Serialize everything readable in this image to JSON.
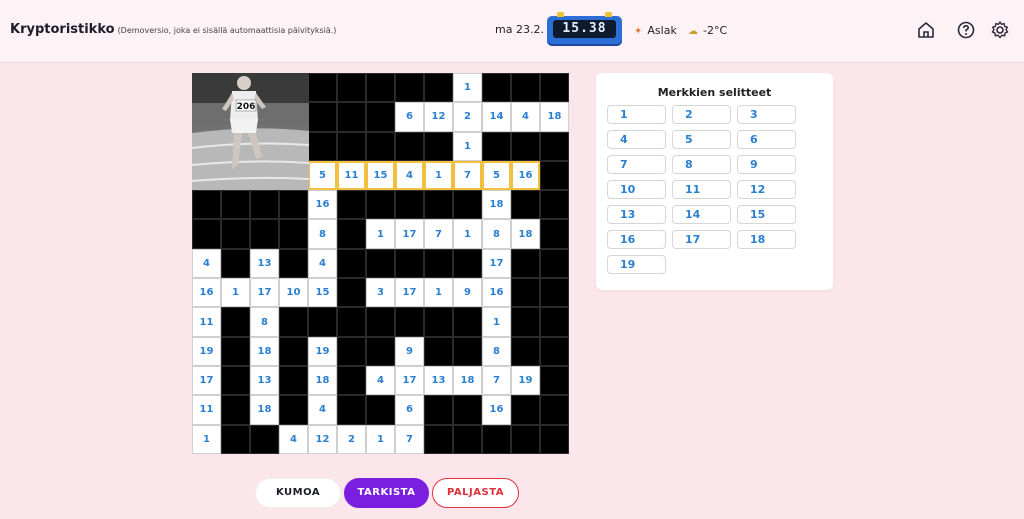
{
  "header": {
    "title": "Kryptoristikko",
    "subtitle": "(Demoversio, joka ei sisällä automaattisia päivityksiä.)",
    "date": "ma 23.2.",
    "clock": "15.38",
    "nameday": "Aslak",
    "weather": "-2°C",
    "icons": [
      "home-icon",
      "help-icon",
      "settings-icon"
    ]
  },
  "puzzle": {
    "photo_number": "206",
    "rows": [
      [
        "P",
        "P",
        "P",
        "P",
        "X",
        "X",
        "X",
        "X",
        "X",
        "1",
        "X",
        "X",
        "X"
      ],
      [
        "P",
        "P",
        "P",
        "P",
        "X",
        "X",
        "X",
        "6",
        "12",
        "2",
        "14",
        "4",
        "18"
      ],
      [
        "P",
        "P",
        "P",
        "P",
        "X",
        "X",
        "X",
        "X",
        "X",
        "1",
        "X",
        "X",
        "X"
      ],
      [
        "P",
        "P",
        "P",
        "P",
        "5",
        "11",
        "15",
        "4",
        "1",
        "7",
        "5",
        "16",
        "X"
      ],
      [
        "X",
        "X",
        "X",
        "X",
        "16",
        "X",
        "X",
        "X",
        "X",
        "X",
        "18",
        "X",
        "X"
      ],
      [
        "X",
        "X",
        "X",
        "X",
        "8",
        "X",
        "1",
        "17",
        "7",
        "1",
        "8",
        "18",
        "X"
      ],
      [
        "4",
        "X",
        "13",
        "X",
        "4",
        "X",
        "X",
        "X",
        "X",
        "X",
        "17",
        "X",
        "X"
      ],
      [
        "16",
        "1",
        "17",
        "10",
        "15",
        "X",
        "3",
        "17",
        "1",
        "9",
        "16",
        "X",
        "X"
      ],
      [
        "11",
        "X",
        "8",
        "X",
        "X",
        "X",
        "X",
        "X",
        "X",
        "X",
        "1",
        "X",
        "X"
      ],
      [
        "19",
        "X",
        "18",
        "X",
        "19",
        "X",
        "X",
        "9",
        "X",
        "X",
        "8",
        "X",
        "X"
      ],
      [
        "17",
        "X",
        "13",
        "X",
        "18",
        "X",
        "4",
        "17",
        "13",
        "18",
        "7",
        "19",
        "X"
      ],
      [
        "11",
        "X",
        "18",
        "X",
        "4",
        "X",
        "X",
        "6",
        "X",
        "X",
        "16",
        "X",
        "X"
      ],
      [
        "1",
        "X",
        "X",
        "4",
        "12",
        "2",
        "1",
        "7",
        "X",
        "X",
        "X",
        "X",
        "X"
      ]
    ],
    "selected_row": 3,
    "selected_cols": [
      4,
      5,
      6,
      7,
      8,
      9,
      10,
      11
    ]
  },
  "legend": {
    "title": "Merkkien selitteet",
    "items": [
      "1",
      "2",
      "3",
      "4",
      "5",
      "6",
      "7",
      "8",
      "9",
      "10",
      "11",
      "12",
      "13",
      "14",
      "15",
      "16",
      "17",
      "18",
      "19"
    ]
  },
  "buttons": {
    "undo": "KUMOA",
    "check": "TARKISTA",
    "reveal": "PALJASTA"
  },
  "colors": {
    "background": "#fbe6ec",
    "number": "#2b7fd0",
    "selection": "#f0c040",
    "check_button": "#7a1fe0",
    "reveal_button": "#e0303a"
  }
}
